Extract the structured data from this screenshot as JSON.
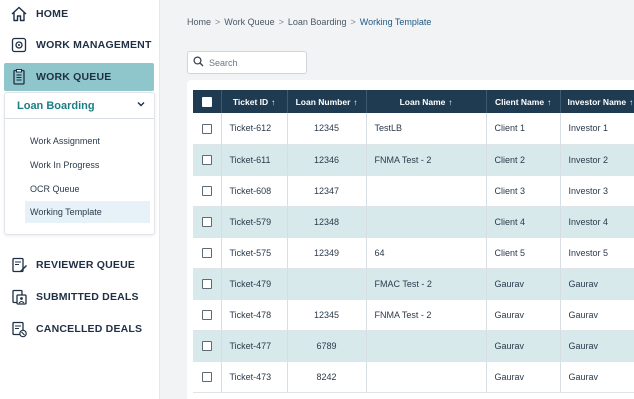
{
  "sidebar": {
    "home": "HOME",
    "work_management": "WORK MANAGEMENT",
    "work_queue": "WORK QUEUE",
    "submenu_title": "Loan Boarding",
    "submenu_items": [
      "Work Assignment",
      "Work In Progress",
      "OCR Queue",
      "Working Template"
    ],
    "reviewer_queue": "REVIEWER QUEUE",
    "submitted_deals": "SUBMITTED DEALS",
    "cancelled_deals": "CANCELLED DEALS"
  },
  "breadcrumb": {
    "items": [
      "Home",
      "Work Queue",
      "Loan Boarding",
      "Working Template"
    ],
    "separator": ">"
  },
  "search": {
    "placeholder": "Search"
  },
  "table": {
    "columns": [
      "Ticket ID",
      "Loan Number",
      "Loan Name",
      "Client Name",
      "Investor Name"
    ],
    "sort_arrow": "↑",
    "rows": [
      [
        "Ticket-612",
        "12345",
        "TestLB",
        "Client 1",
        "Investor 1"
      ],
      [
        "Ticket-611",
        "12346",
        "FNMA Test - 2",
        "Client 2",
        "Investor 2"
      ],
      [
        "Ticket-608",
        "12347",
        "",
        "Client 3",
        "Investor 3"
      ],
      [
        "Ticket-579",
        "12348",
        "",
        "Client 4",
        "Investor 4"
      ],
      [
        "Ticket-575",
        "12349",
        "64",
        "Client 5",
        "Investor 5"
      ],
      [
        "Ticket-479",
        "",
        "FMAC Test - 2",
        "Gaurav",
        "Gaurav"
      ],
      [
        "Ticket-478",
        "12345",
        "FNMA Test - 2",
        "Gaurav",
        "Gaurav"
      ],
      [
        "Ticket-477",
        "6789",
        "",
        "Gaurav",
        "Gaurav"
      ],
      [
        "Ticket-473",
        "8242",
        "",
        "Gaurav",
        "Gaurav"
      ]
    ]
  },
  "colors": {
    "accent": "#8ec6cc",
    "header_bg": "#1f3b52",
    "row_alt": "#d7e9ea",
    "link": "#1b7e85"
  }
}
